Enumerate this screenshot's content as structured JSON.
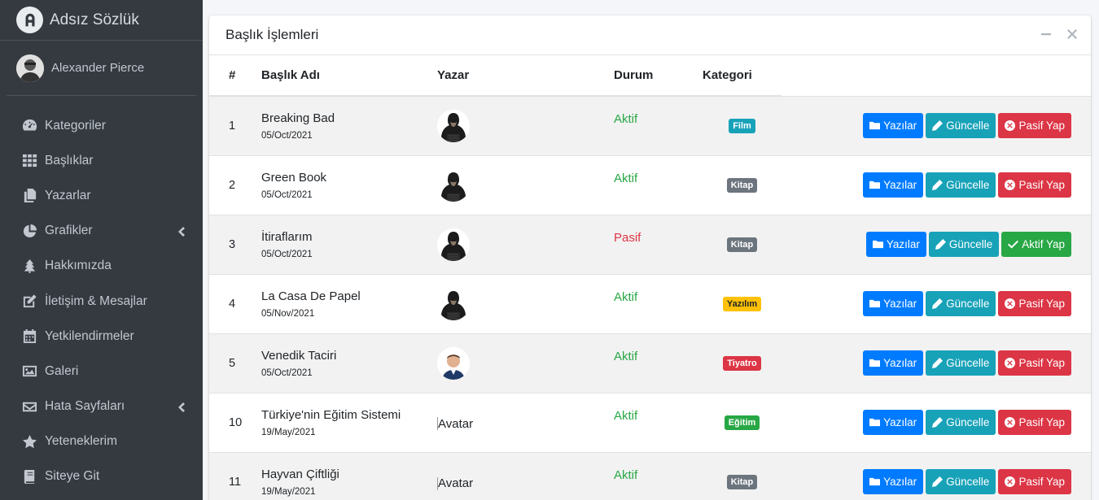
{
  "brand": {
    "title": "Adsız Sözlük"
  },
  "user": {
    "name": "Alexander Pierce"
  },
  "sidebar": {
    "items": [
      {
        "label": "Kategoriler",
        "icon": "dashboard-gauge-icon"
      },
      {
        "label": "Başlıklar",
        "icon": "grid-icon"
      },
      {
        "label": "Yazarlar",
        "icon": "copy-icon"
      },
      {
        "label": "Grafikler",
        "icon": "pie-chart-icon",
        "caret": true
      },
      {
        "label": "Hakkımızda",
        "icon": "tree-icon"
      },
      {
        "label": "İletişim & Mesajlar",
        "icon": "edit-icon"
      },
      {
        "label": "Yetkilendirmeler",
        "icon": "calendar-icon"
      },
      {
        "label": "Galeri",
        "icon": "image-icon"
      },
      {
        "label": "Hata Sayfaları",
        "icon": "envelope-icon",
        "caret": true
      },
      {
        "label": "Yeteneklerim",
        "icon": "star-icon"
      },
      {
        "label": "Siteye Git",
        "icon": "book-icon"
      }
    ]
  },
  "card": {
    "title": "Başlık İşlemleri",
    "columns": {
      "num": "#",
      "title": "Başlık Adı",
      "author": "Yazar",
      "status": "Durum",
      "category": "Kategori"
    }
  },
  "rows": [
    {
      "num": "1",
      "title": "Breaking Bad",
      "date": "05/Oct/2021",
      "avatar": "hooded",
      "status": "Aktif",
      "status_color": "green",
      "category": "Film",
      "category_color": "#17a2b8",
      "toggle": "Pasif Yap"
    },
    {
      "num": "2",
      "title": "Green Book",
      "date": "05/Oct/2021",
      "avatar": "hooded",
      "status": "Aktif",
      "status_color": "green",
      "category": "Kitap",
      "category_color": "#6c757d",
      "toggle": "Pasif Yap"
    },
    {
      "num": "3",
      "title": "İtiraflarım",
      "date": "05/Oct/2021",
      "avatar": "hooded",
      "status": "Pasif",
      "status_color": "red",
      "category": "Kitap",
      "category_color": "#6c757d",
      "toggle": "Aktif Yap"
    },
    {
      "num": "4",
      "title": "La Casa De Papel",
      "date": "05/Nov/2021",
      "avatar": "hooded",
      "status": "Aktif",
      "status_color": "green",
      "category": "Yazılım",
      "category_color": "#ffc107",
      "toggle": "Pasif Yap"
    },
    {
      "num": "5",
      "title": "Venedik Taciri",
      "date": "05/Oct/2021",
      "avatar": "man",
      "status": "Aktif",
      "status_color": "green",
      "category": "Tiyatro",
      "category_color": "#dc3545",
      "toggle": "Pasif Yap"
    },
    {
      "num": "10",
      "title": "Türkiye'nin Eğitim Sistemi",
      "date": "19/May/2021",
      "avatar": "broken",
      "avatar_alt": "Avatar",
      "status": "Aktif",
      "status_color": "green",
      "category": "Eğitim",
      "category_color": "#28a745",
      "toggle": "Pasif Yap"
    },
    {
      "num": "11",
      "title": "Hayvan Çiftliği",
      "date": "19/May/2021",
      "avatar": "broken",
      "avatar_alt": "Avatar",
      "status": "Aktif",
      "status_color": "green",
      "category": "Kitap",
      "category_color": "#6c757d",
      "toggle": "Pasif Yap"
    }
  ],
  "buttons": {
    "posts": "Yazılar",
    "update": "Güncelle"
  },
  "colors": {
    "sidebar": "#343a40",
    "primary": "#007bff",
    "info": "#17a2b8",
    "danger": "#dc3545",
    "success": "#28a745"
  }
}
